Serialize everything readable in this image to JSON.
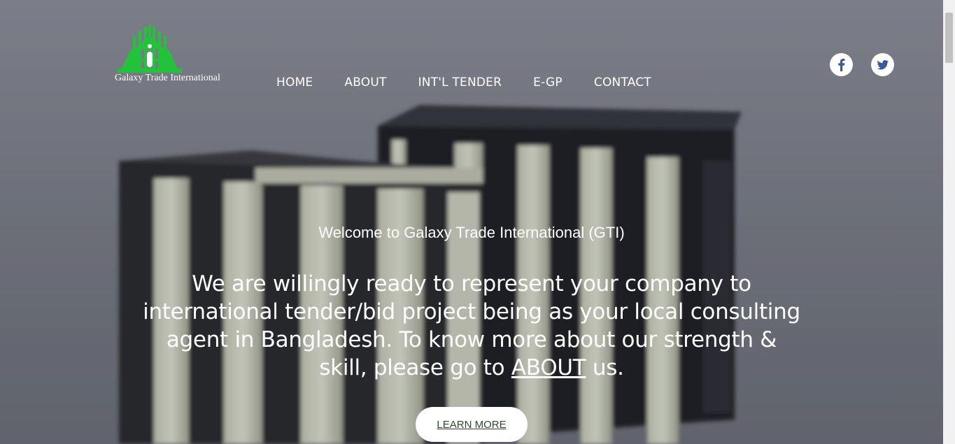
{
  "brand": {
    "name": "Galaxy Trade International",
    "logo_color": "#22c33a"
  },
  "nav": {
    "items": [
      {
        "label": "HOME"
      },
      {
        "label": "ABOUT"
      },
      {
        "label": "INT'L TENDER"
      },
      {
        "label": "E-GP"
      },
      {
        "label": "CONTACT"
      }
    ]
  },
  "social": {
    "facebook_icon": "facebook-icon",
    "twitter_icon": "twitter-icon",
    "icon_color": "#3b5998"
  },
  "hero": {
    "welcome": "Welcome to Galaxy Trade International (GTI)",
    "tagline_before": "We are willingly ready to represent your company to international tender/bid project being as your local consulting agent in Bangladesh. To know more about our strength & skill, please go to ",
    "tagline_link": "ABOUT",
    "tagline_after": " us.",
    "cta_label": "LEARN MORE",
    "cta_text_color": "#2e4a2e"
  }
}
